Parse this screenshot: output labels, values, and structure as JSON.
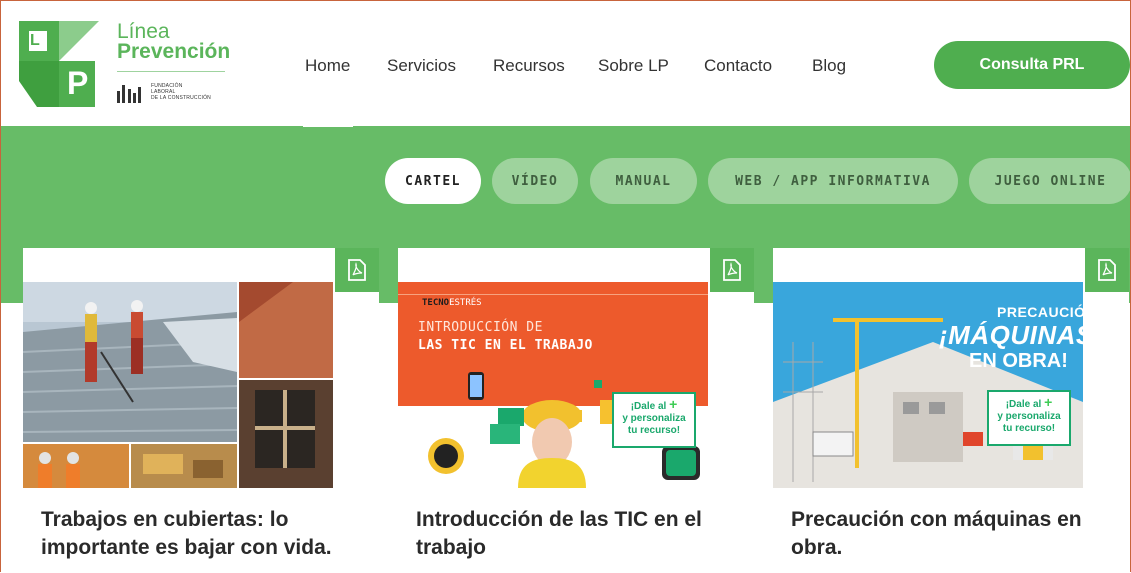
{
  "brand": {
    "line1": "Línea",
    "line2": "Prevención",
    "fund_line1": "FUNDACIÓN",
    "fund_line2": "LABORAL",
    "fund_line3": "DE LA CONSTRUCCIÓN",
    "letter_l": "L",
    "letter_p": "P"
  },
  "nav": {
    "items": [
      {
        "label": "Home"
      },
      {
        "label": "Servicios"
      },
      {
        "label": "Recursos"
      },
      {
        "label": "Sobre LP"
      },
      {
        "label": "Contacto"
      },
      {
        "label": "Blog"
      }
    ],
    "cta": "Consulta PRL"
  },
  "filters": [
    {
      "label": "CARTEL",
      "active": true
    },
    {
      "label": "VÍDEO"
    },
    {
      "label": "MANUAL"
    },
    {
      "label": "WEB / APP INFORMATIVA"
    },
    {
      "label": "JUEGO ONLINE"
    }
  ],
  "cards": [
    {
      "title": "Trabajos en cubiertas: lo importante es bajar con vida.",
      "icon": "pdf-icon"
    },
    {
      "title": "Introducción de las TIC en el trabajo",
      "icon": "pdf-icon",
      "poster_brand_a": "TECNO",
      "poster_brand_b": "ESTRÉS",
      "poster_line1": "INTRODUCCIÓN DE",
      "poster_line2": "LAS TIC EN EL TRABAJO",
      "badge_line1": "¡Dale al",
      "badge_plus": "+",
      "badge_line2": "y personaliza",
      "badge_line3": "tu recurso!"
    },
    {
      "title": "Precaución con máquinas en obra.",
      "icon": "pdf-icon",
      "poster_line1": "PRECAUCIÓN",
      "poster_line2": "¡MÁQUINAS",
      "poster_line3": "EN OBRA!",
      "badge_line1": "¡Dale al",
      "badge_plus": "+",
      "badge_line2": "y personaliza",
      "badge_line3": "tu recurso!"
    }
  ],
  "colors": {
    "brand_green": "#5bb55b",
    "band_green": "#67bc67",
    "pill_inactive": "#9ed39d"
  }
}
